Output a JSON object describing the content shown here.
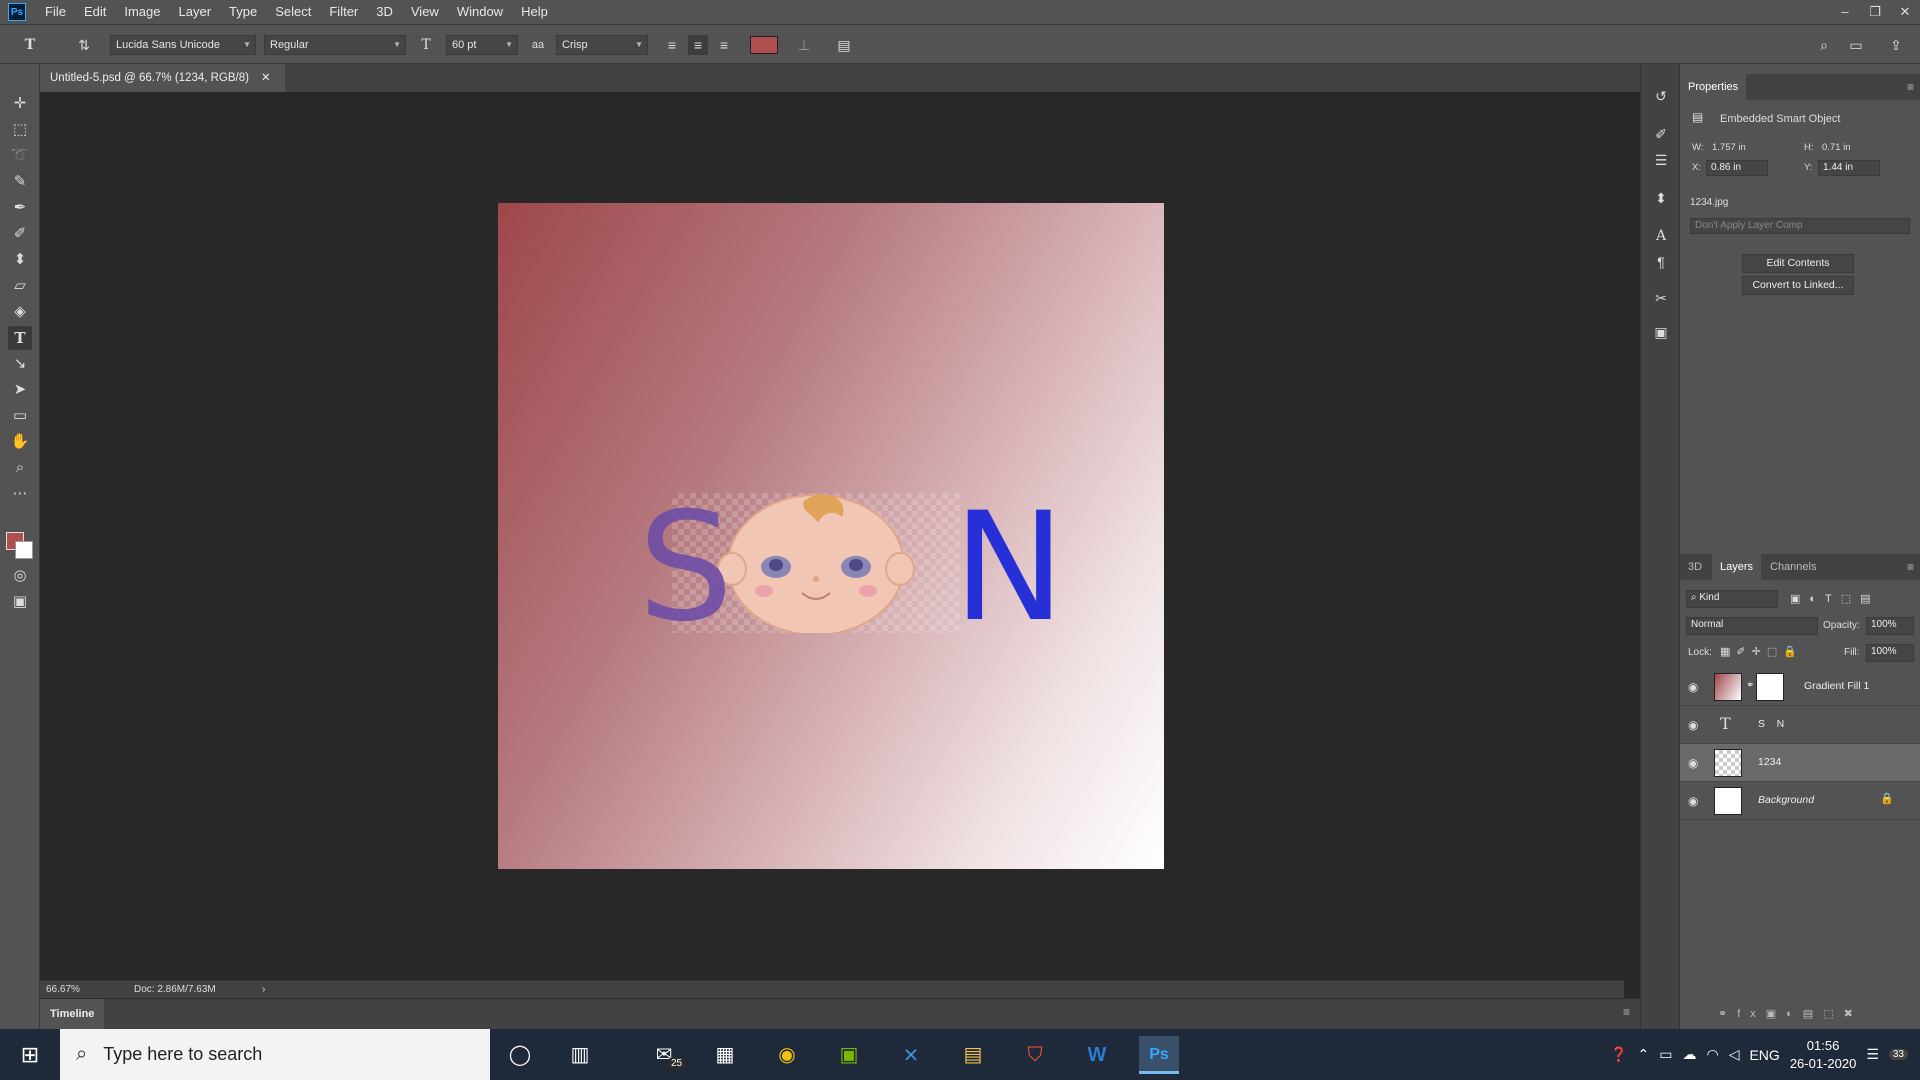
{
  "menu": [
    "File",
    "Edit",
    "Image",
    "Layer",
    "Type",
    "Select",
    "Filter",
    "3D",
    "View",
    "Window",
    "Help"
  ],
  "app_logo": "Ps",
  "options": {
    "font_family": "Lucida Sans Unicode",
    "font_style": "Regular",
    "font_size": "60 pt",
    "antialias": "Crisp",
    "text_color": "#b04f4f"
  },
  "document": {
    "tab_title": "Untitled-5.psd @ 66.7% (1234, RGB/8)",
    "zoom": "66.67%",
    "doc_info": "Doc: 2.86M/7.63M",
    "letter_s": "S",
    "letter_n": "N"
  },
  "timeline_label": "Timeline",
  "properties": {
    "title": "Properties",
    "type_label": "Embedded Smart Object",
    "w_label": "W:",
    "w_value": "1.757 in",
    "h_label": "H:",
    "h_value": "0.71 in",
    "x_label": "X:",
    "x_value": "0.86 in",
    "y_label": "Y:",
    "y_value": "1.44 in",
    "filename": "1234.jpg",
    "layer_comp": "Don't Apply Layer Comp",
    "edit_contents": "Edit Contents",
    "convert_linked": "Convert to Linked..."
  },
  "layers_panel": {
    "tabs": [
      "3D",
      "Layers",
      "Channels"
    ],
    "kind": "Kind",
    "blend_mode": "Normal",
    "opacity_label": "Opacity:",
    "opacity": "100%",
    "lock_label": "Lock:",
    "fill_label": "Fill:",
    "fill": "100%",
    "layers": [
      {
        "name": "Gradient Fill 1"
      },
      {
        "name": "S    N"
      },
      {
        "name": "1234"
      },
      {
        "name": "Background"
      }
    ]
  },
  "taskbar": {
    "search_placeholder": "Type here to search",
    "mail_badge": "25",
    "language": "ENG",
    "time": "01:56",
    "date": "26-01-2020",
    "notification_count": "33"
  }
}
